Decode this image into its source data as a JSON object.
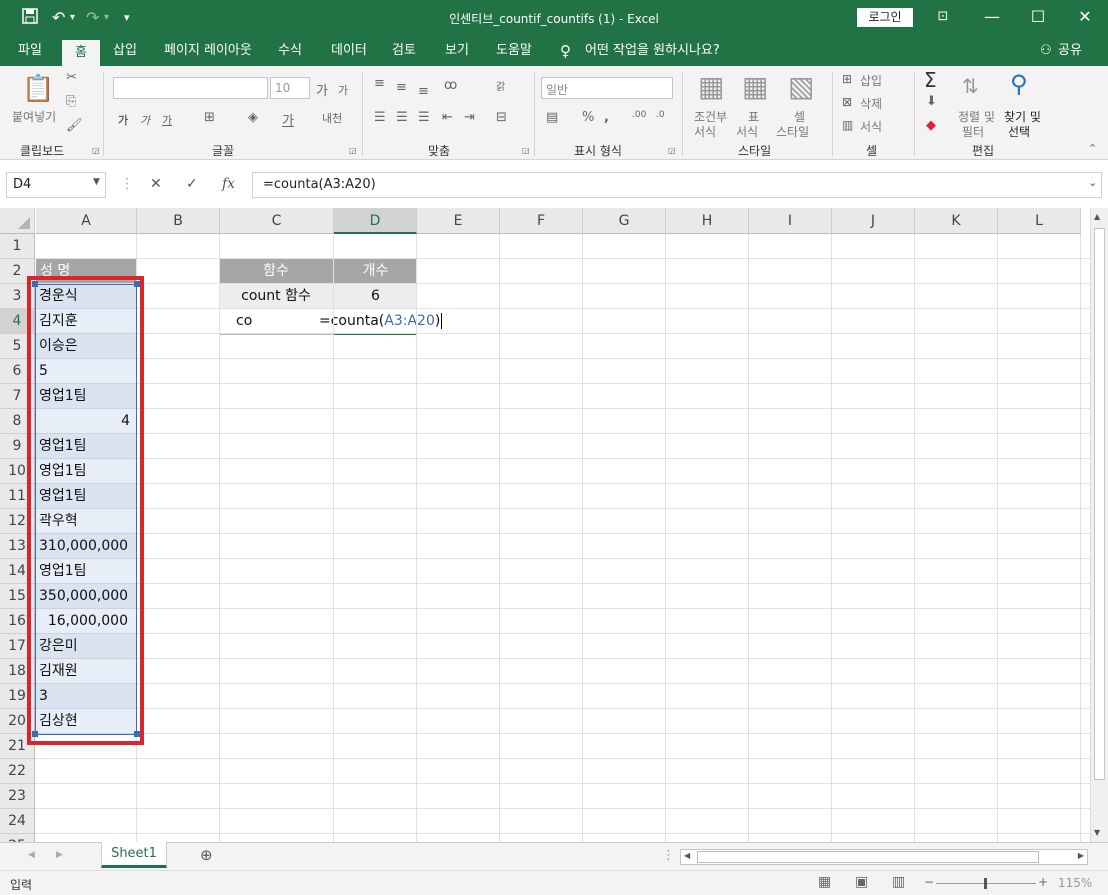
{
  "window": {
    "title": "인센티브_countif_countifs (1)  -  Excel",
    "login": "로그인"
  },
  "tabs": [
    "파일",
    "홈",
    "삽입",
    "페이지 레이아웃",
    "수식",
    "데이터",
    "검토",
    "보기",
    "도움말"
  ],
  "tell_me": "어떤 작업을 원하시나요?",
  "share": "공유",
  "ribbon": {
    "clipboard": {
      "label": "클립보드",
      "paste": "붙여넣기"
    },
    "font": {
      "label": "글꼴",
      "size": "10"
    },
    "align": {
      "label": "맞춤"
    },
    "number": {
      "label": "표시 형식",
      "format": "일반"
    },
    "styles": {
      "label": "스타일",
      "cond": [
        "조건부",
        "서식"
      ],
      "table": [
        "표",
        "서식"
      ],
      "cell": [
        "셀",
        "스타일"
      ]
    },
    "cells": {
      "label": "셀",
      "insert": "삽입",
      "delete": "삭제",
      "format": "서식"
    },
    "edit": {
      "label": "편집",
      "sort": [
        "정렬 및",
        "필터"
      ],
      "find": [
        "찾기 및",
        "선택"
      ]
    }
  },
  "formula_bar": {
    "name_box": "D4",
    "formula": "=counta(A3:A20)"
  },
  "columns": [
    "A",
    "B",
    "C",
    "D",
    "E",
    "F",
    "G",
    "H",
    "I",
    "J",
    "K",
    "L"
  ],
  "rows": [
    "1",
    "2",
    "3",
    "4",
    "5",
    "6",
    "7",
    "8",
    "9",
    "10",
    "11",
    "12",
    "13",
    "14",
    "15",
    "16",
    "17",
    "18",
    "19",
    "20",
    "21",
    "22",
    "23",
    "24",
    "25"
  ],
  "cells": {
    "A2": "성  명",
    "A": [
      "경운식",
      "김지훈",
      "이승은",
      "5",
      "영업1팀",
      "4",
      "영업1팀",
      "영업1팀",
      "영업1팀",
      "곽우혁",
      "310,000,000",
      "영업1팀",
      "350,000,000",
      "16,000,000",
      "강은미",
      "김재원",
      "3",
      "김상현"
    ],
    "C2": "함수",
    "D2": "개수",
    "C3": "count 함수",
    "D3": "6",
    "C4": "co",
    "D4_prefix": "=counta(",
    "D4_ref": "A3:A20",
    "D4_suffix": ")"
  },
  "sheet_tab": "Sheet1",
  "status": {
    "mode": "입력",
    "zoom": "115%"
  },
  "colors": {
    "accent": "#217346",
    "highlight": "#d9262c",
    "ref": "#3b6bb5"
  }
}
